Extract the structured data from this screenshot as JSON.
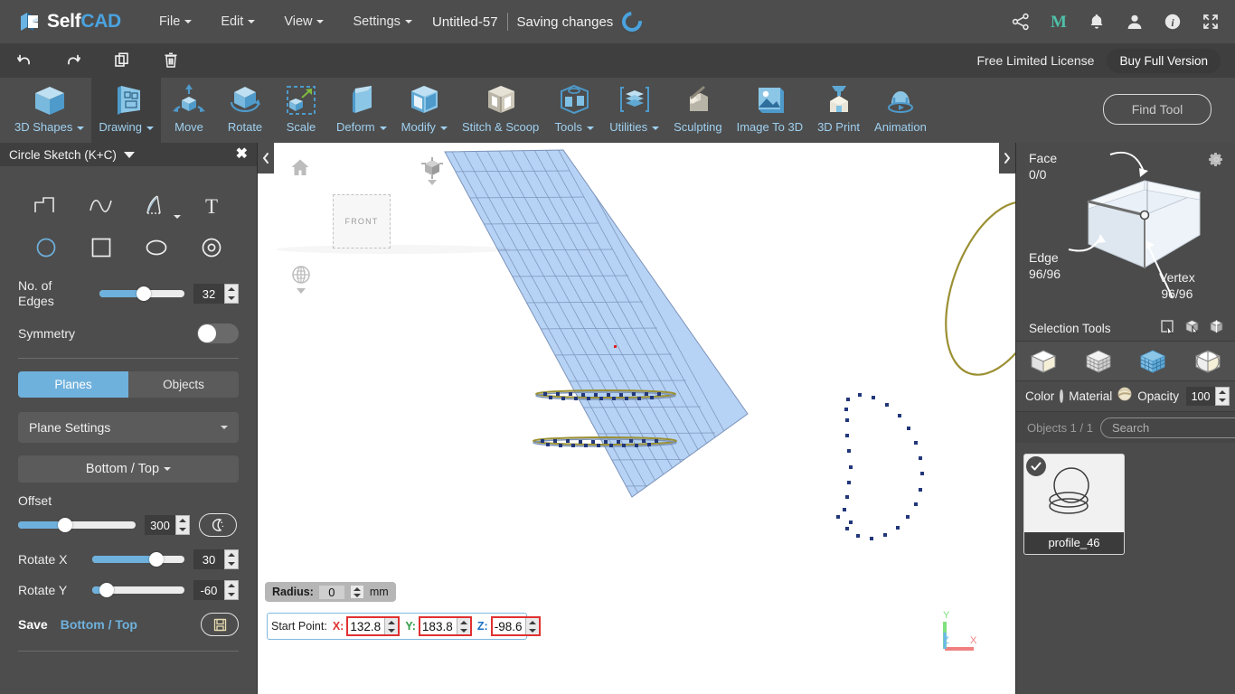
{
  "app": {
    "logo_self": "Self",
    "logo_cad": "CAD",
    "menus": [
      "File",
      "Edit",
      "View",
      "Settings"
    ],
    "doc_title": "Untitled-57",
    "save_status": "Saving changes",
    "top_icons": [
      "share-icon",
      "myminifactory-icon",
      "notifications-icon",
      "account-icon",
      "info-icon",
      "fullscreen-icon"
    ]
  },
  "secondbar": {
    "history": [
      "undo-icon",
      "redo-icon",
      "copy-icon",
      "delete-icon"
    ],
    "license_text": "Free Limited License",
    "buy_label": "Buy Full Version"
  },
  "ribbon": {
    "items": [
      {
        "label": "3D Shapes",
        "icon": "cube-icon",
        "caret": true,
        "active": false
      },
      {
        "label": "Drawing",
        "icon": "drawing-icon",
        "caret": true,
        "active": true
      },
      {
        "label": "Move",
        "icon": "move-icon",
        "caret": false,
        "active": false
      },
      {
        "label": "Rotate",
        "icon": "rotate-icon",
        "caret": false,
        "active": false
      },
      {
        "label": "Scale",
        "icon": "scale-icon",
        "caret": false,
        "active": false
      },
      {
        "label": "Deform",
        "icon": "deform-icon",
        "caret": true,
        "active": false
      },
      {
        "label": "Modify",
        "icon": "modify-icon",
        "caret": true,
        "active": false
      },
      {
        "label": "Stitch & Scoop",
        "icon": "stitch-scoop-icon",
        "caret": false,
        "active": false
      },
      {
        "label": "Tools",
        "icon": "tools-icon",
        "caret": true,
        "active": false
      },
      {
        "label": "Utilities",
        "icon": "utilities-icon",
        "caret": true,
        "active": false
      },
      {
        "label": "Sculpting",
        "icon": "sculpting-icon",
        "caret": false,
        "active": false
      },
      {
        "label": "Image To 3D",
        "icon": "image-to-3d-icon",
        "caret": false,
        "active": false
      },
      {
        "label": "3D Print",
        "icon": "3d-print-icon",
        "caret": false,
        "active": false
      },
      {
        "label": "Animation",
        "icon": "animation-icon",
        "caret": false,
        "active": false
      }
    ],
    "find_tool_placeholder": "Find Tool"
  },
  "left_panel": {
    "title": "Circle Sketch (K+C)",
    "close_label": "✖",
    "sketch_tools": [
      "polyline-icon",
      "freehand-curve-icon",
      "pen-icon",
      "text-icon",
      "circle-icon",
      "rectangle-icon",
      "ellipse-icon",
      "concentric-circle-icon"
    ],
    "edges": {
      "label": "No. of Edges",
      "value": "32",
      "percent": 52
    },
    "symmetry": {
      "label": "Symmetry",
      "on": false
    },
    "mode_tabs": {
      "planes": "Planes",
      "objects": "Objects",
      "selected": "Planes"
    },
    "plane_settings_label": "Plane Settings",
    "plane_choice": "Bottom / Top",
    "offset": {
      "label": "Offset",
      "value": "300",
      "percent": 40
    },
    "rotate_x": {
      "label": "Rotate X",
      "value": "30",
      "percent": 75
    },
    "rotate_y": {
      "label": "Rotate Y",
      "value": "-60",
      "percent": 18
    },
    "save": {
      "label": "Save",
      "value": "Bottom / Top",
      "icon": "floppy-icon"
    }
  },
  "viewport": {
    "front_cube_label": "FRONT",
    "home_icon": "home-icon",
    "view_cube_icon": "view-cube-icon",
    "pivot_icon": "pivot-icon",
    "radius": {
      "label": "Radius:",
      "value": "0",
      "unit": "mm"
    },
    "start_point": {
      "label": "Start Point:",
      "x_label": "X:",
      "x": "132.8",
      "y_label": "Y:",
      "y": "183.8",
      "z_label": "Z:",
      "z": "-98.6"
    },
    "axis_gizmo": {
      "x": "X",
      "y": "Y",
      "z": "Z"
    },
    "colors": {
      "plane_fill": "#b6d2f5",
      "plane_stroke": "#7b93b8",
      "sketch_stroke": "#9b9033",
      "vertex": "#22377a",
      "origin_dot": "#e02020",
      "axis_x": "#f08080",
      "axis_y": "#7fe07f",
      "axis_z": "#6cb7f0"
    }
  },
  "right_panel": {
    "stats": {
      "face_label": "Face",
      "face_value": "0/0",
      "edge_label": "Edge",
      "edge_value": "96/96",
      "vertex_label": "Vertex",
      "vertex_value": "96/96"
    },
    "gear_icon": "gear-icon",
    "selection_tools_label": "Selection Tools",
    "selection_tool_icons": [
      "rect-select-icon",
      "box-select-icon",
      "loop-select-icon"
    ],
    "mode_icons": [
      "object-mode-icon",
      "vertex-mode-icon",
      "face-mode-icon",
      "edge-mode-icon"
    ],
    "color_label": "Color",
    "material_label": "Material",
    "opacity_label": "Opacity",
    "opacity_value": "100",
    "objects_count": "Objects 1 / 1",
    "search_placeholder": "Search",
    "objects": [
      {
        "name": "profile_46",
        "selected": true,
        "thumb": "three-circles-sketch"
      }
    ]
  }
}
